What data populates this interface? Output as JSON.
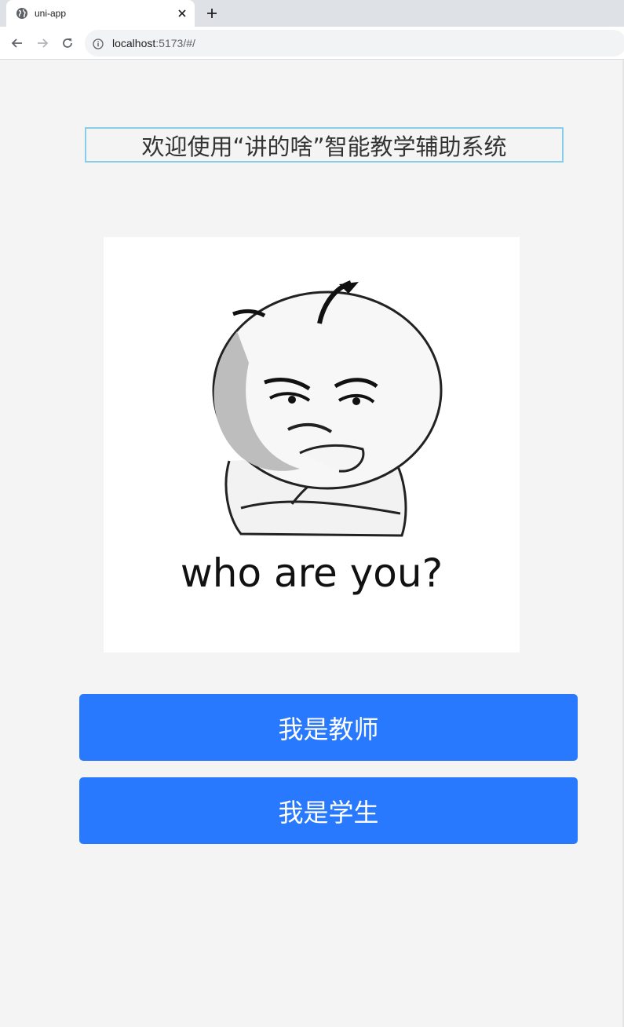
{
  "browser": {
    "tab_title": "uni-app",
    "url_host": "localhost",
    "url_path": ":5173/#/",
    "icons": {
      "favicon": "globe-icon",
      "tab_close": "close-icon",
      "new_tab": "plus-icon",
      "back": "arrow-left-icon",
      "forward": "arrow-right-icon",
      "reload": "reload-icon",
      "site_info": "info-icon"
    }
  },
  "page": {
    "welcome_text": "欢迎使用“讲的啥”智能教学辅助系统",
    "image_caption": "who are you?",
    "teacher_button": "我是教师",
    "student_button": "我是学生"
  },
  "colors": {
    "page_background": "#f4f4f4",
    "welcome_border": "#87ceeb",
    "button_primary": "#2979ff",
    "button_text": "#ffffff"
  }
}
